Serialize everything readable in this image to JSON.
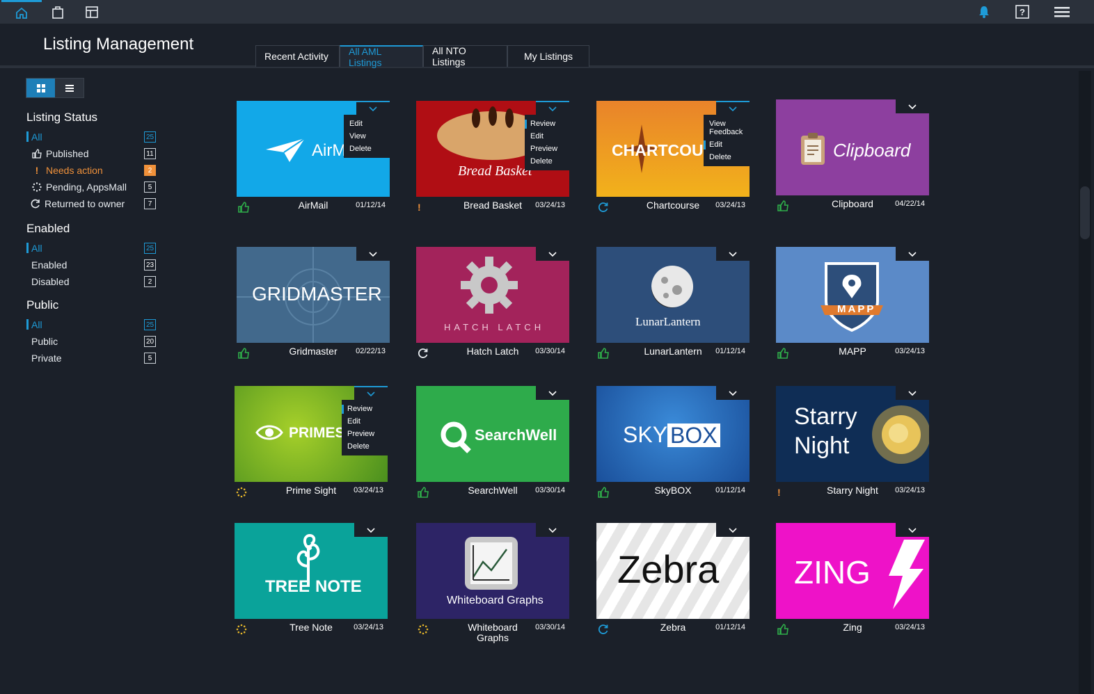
{
  "topbar": {
    "icons": [
      "home-icon",
      "shopping-bag-icon",
      "layout-icon",
      "bell-icon",
      "help-icon",
      "hamburger-menu-icon"
    ]
  },
  "header": {
    "title": "Listing Management",
    "tabs": [
      {
        "label": "Recent Activity",
        "active": false
      },
      {
        "label": "All AML Listings",
        "active": true
      },
      {
        "label": "All NTO Listings",
        "active": false
      },
      {
        "label": "My Listings",
        "active": false
      }
    ]
  },
  "sidebar": {
    "listing_status": {
      "title": "Listing Status",
      "items": [
        {
          "label": "All",
          "count": "25"
        },
        {
          "label": "Published",
          "count": "11"
        },
        {
          "label": "Needs action",
          "count": "2"
        },
        {
          "label": "Pending, AppsMall",
          "count": "5"
        },
        {
          "label": "Returned to owner",
          "count": "7"
        }
      ]
    },
    "enabled": {
      "title": "Enabled",
      "items": [
        {
          "label": "All",
          "count": "25"
        },
        {
          "label": "Enabled",
          "count": "23"
        },
        {
          "label": "Disabled",
          "count": "2"
        }
      ]
    },
    "public": {
      "title": "Public",
      "items": [
        {
          "label": "All",
          "count": "25"
        },
        {
          "label": "Public",
          "count": "20"
        },
        {
          "label": "Private",
          "count": "5"
        }
      ]
    }
  },
  "colors": {
    "accent": "#1e9bd7",
    "published": "#2fae4a",
    "needs_action": "#f0913a",
    "pending": "#e8b82a"
  },
  "listings": [
    {
      "name": "AirMail",
      "date": "01/12/14",
      "status": "published",
      "logo": "AirM",
      "menu": [
        "Edit",
        "View",
        "Delete"
      ]
    },
    {
      "name": "Bread Basket",
      "date": "03/24/13",
      "status": "needs-action",
      "logo": "Bread Basket",
      "menu": [
        "Review",
        "Edit",
        "Preview",
        "Delete"
      ]
    },
    {
      "name": "Chartcourse",
      "date": "03/24/13",
      "status": "returned",
      "logo": "CHARTCOU",
      "menu": [
        "View Feedback",
        "Edit",
        "Delete"
      ]
    },
    {
      "name": "Clipboard",
      "date": "04/22/14",
      "status": "published",
      "logo": "Clipboard"
    },
    {
      "name": "Gridmaster",
      "date": "02/22/13",
      "status": "published",
      "logo": "GRIDMASTER"
    },
    {
      "name": "Hatch Latch",
      "date": "03/30/14",
      "status": "returned",
      "logo": "HATCH LATCH"
    },
    {
      "name": "LunarLantern",
      "date": "01/12/14",
      "status": "published",
      "logo": "LunarLantern"
    },
    {
      "name": "MAPP",
      "date": "03/24/13",
      "status": "published",
      "logo": "MAPP"
    },
    {
      "name": "Prime Sight",
      "date": "03/24/13",
      "status": "pending",
      "logo": "PRIMESI",
      "menu": [
        "Review",
        "Edit",
        "Preview",
        "Delete"
      ]
    },
    {
      "name": "SearchWell",
      "date": "03/30/14",
      "status": "published",
      "logo": "SearchWell"
    },
    {
      "name": "SkyBOX",
      "date": "01/12/14",
      "status": "published",
      "logo_a": "SKY",
      "logo_b": "BOX"
    },
    {
      "name": "Starry Night",
      "date": "03/24/13",
      "status": "needs-action",
      "logo_a": "Starry",
      "logo_b": "Night"
    },
    {
      "name": "Tree Note",
      "date": "03/24/13",
      "status": "pending",
      "logo_a": "TREE",
      "logo_b": "NOTE"
    },
    {
      "name": "Whiteboard Graphs",
      "date": "03/30/14",
      "status": "pending",
      "logo": "Whiteboard Graphs"
    },
    {
      "name": "Zebra",
      "date": "01/12/14",
      "status": "returned",
      "logo": "Zebra"
    },
    {
      "name": "Zing",
      "date": "03/24/13",
      "status": "published",
      "logo": "ZING"
    }
  ]
}
